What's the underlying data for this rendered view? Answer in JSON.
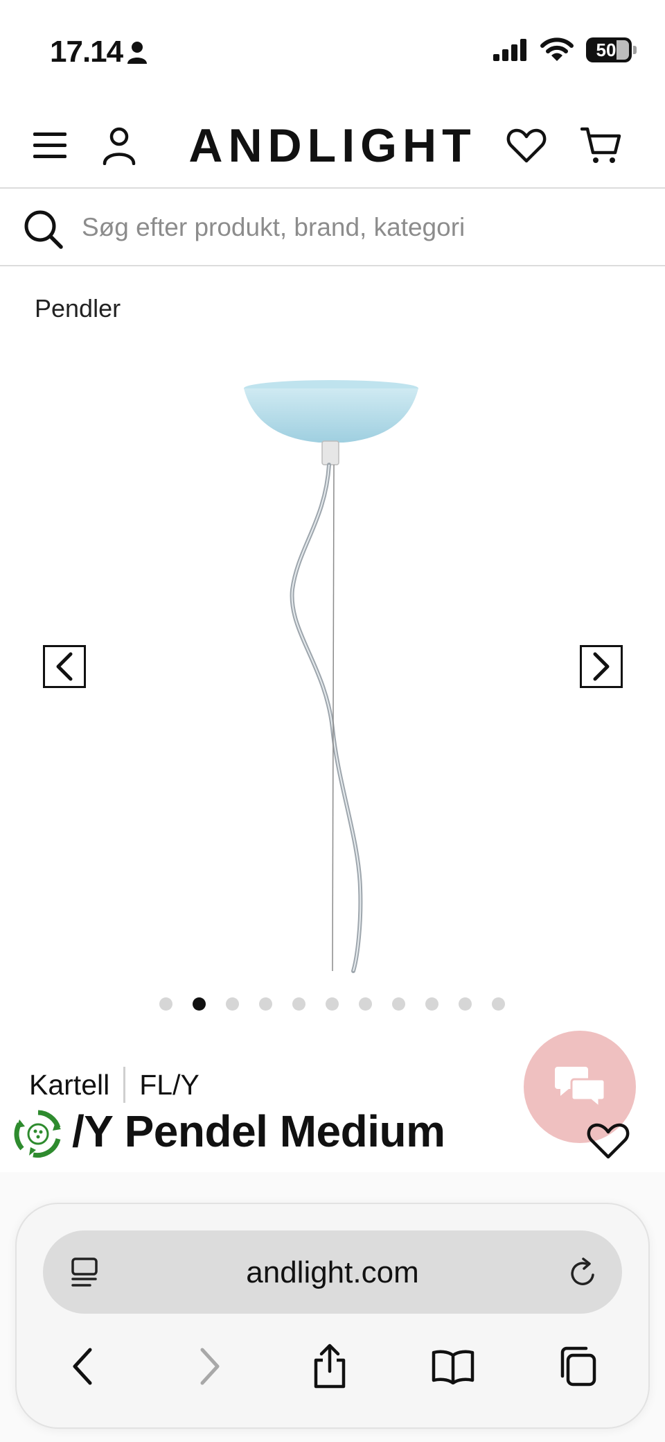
{
  "status_bar": {
    "time": "17.14",
    "battery_level": "50"
  },
  "header": {
    "logo": "ANDLIGHT"
  },
  "search": {
    "placeholder": "Søg efter produkt, brand, kategori"
  },
  "breadcrumb": {
    "category": "Pendler"
  },
  "gallery": {
    "slide_count": 11,
    "active_index": 1
  },
  "product": {
    "brand": "Kartell",
    "collection": "FL/Y",
    "title": "/Y Pendel Medium"
  },
  "browser": {
    "url": "andlight.com"
  },
  "colors": {
    "chat_button_bg": "#efc0c0",
    "eco_green": "#2e8b2e",
    "lamp_blue": "#a9d6e5"
  },
  "icons": {
    "menu": "menu-icon",
    "account": "user-icon",
    "wishlist": "heart-icon",
    "cart": "cart-icon",
    "search": "search-icon",
    "chat": "chat-bubbles-icon",
    "eco": "recycle-badge-icon"
  }
}
